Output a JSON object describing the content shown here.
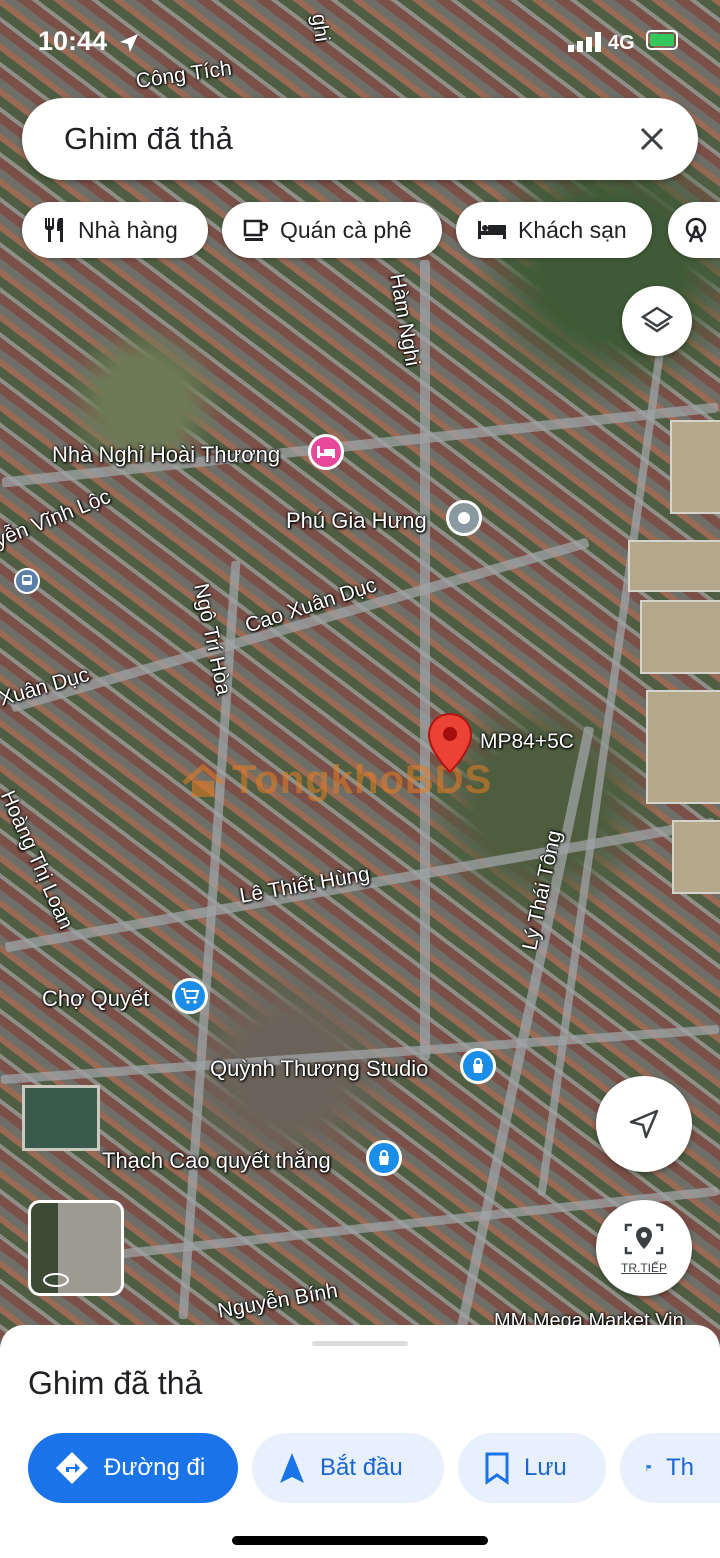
{
  "status_bar": {
    "time": "10:44",
    "network": "4G"
  },
  "search": {
    "title": "Ghim đã thả"
  },
  "chips": [
    {
      "label": "Nhà hàng",
      "icon": "fork-knife-icon"
    },
    {
      "label": "Quán cà phê",
      "icon": "coffee-cup-icon"
    },
    {
      "label": "Khách sạn",
      "icon": "bed-icon"
    },
    {
      "label": "",
      "icon": "ferris-wheel-icon"
    }
  ],
  "map": {
    "streets": [
      "Công Tích",
      "Hàm Nghi",
      "Cao Xuân Dục",
      "Ngô Trí Hòa",
      "Xuân Dục",
      "Hoàng Thị Loan",
      "Lê Thiết Hùng",
      "Lý Thái Tông",
      "Nguyễn Bính",
      "yễn Vĩnh Lộc",
      "ghi"
    ],
    "pois": [
      {
        "name": "Nhà Nghỉ Hoài Thương",
        "type": "hotel",
        "color": "#e8489a"
      },
      {
        "name": "Phú Gia Hưng",
        "type": "place",
        "color": "#8a9aa0"
      },
      {
        "name": "Chợ Quyết",
        "type": "shopping",
        "color": "#1a8de8"
      },
      {
        "name": "Quỳnh Thương Studio",
        "type": "shopping",
        "color": "#1a8de8"
      },
      {
        "name": "Thạch Cao quyết thắng",
        "type": "shopping",
        "color": "#1a8de8"
      }
    ],
    "pin_code": "MP84+5C",
    "watermark": "TongkhoBDS",
    "bottom_edge_label": "MM Mega Market Vin",
    "live_label": "TR.TIẾP"
  },
  "sheet": {
    "title": "Ghim đã thả",
    "actions": [
      {
        "label": "Đường đi",
        "primary": true
      },
      {
        "label": "Bắt đầu",
        "primary": false
      },
      {
        "label": "Lưu",
        "primary": false
      },
      {
        "label": "Th",
        "primary": false
      }
    ]
  },
  "colors": {
    "accent": "#1a73e8",
    "pin": "#ea4335",
    "chip_bg": "#ffffff",
    "secondary_btn": "#e8f0fe"
  }
}
